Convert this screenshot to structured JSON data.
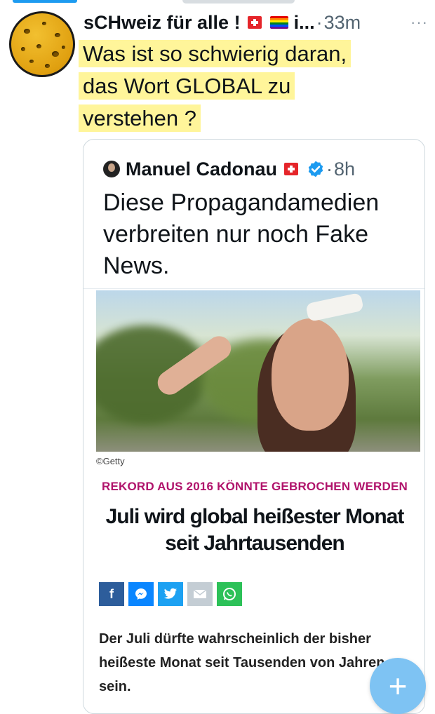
{
  "tweet": {
    "author": "sCHweiz für alle !",
    "author_truncated": "i...",
    "separator": "·",
    "time": "33m",
    "more_label": "···",
    "text_lines": [
      "Was ist so schwierig daran,",
      "das Wort GLOBAL zu",
      "verstehen ?"
    ]
  },
  "quoted_tweet": {
    "author": "Manuel Cadonau",
    "separator": "·",
    "time": "8h",
    "text": "Diese Propagandamedien verbreiten nur noch Fake News."
  },
  "article": {
    "photo_credit": "©Getty",
    "kicker": "REKORD AUS 2016 KÖNNTE GEBROCHEN WERDEN",
    "headline": "Juli wird global heißester Monat seit Jahrtausenden",
    "share_icons": [
      "facebook-icon",
      "messenger-icon",
      "twitter-icon",
      "mail-icon",
      "whatsapp-icon"
    ],
    "lead": "Der Juli dürfte wahrscheinlich der bisher heißeste Monat seit Tausenden von Jahren sein."
  },
  "compose_button": {
    "label": "+"
  },
  "colors": {
    "accent": "#1d9bf0",
    "highlight": "#fff59a",
    "kicker": "#b0136b"
  }
}
